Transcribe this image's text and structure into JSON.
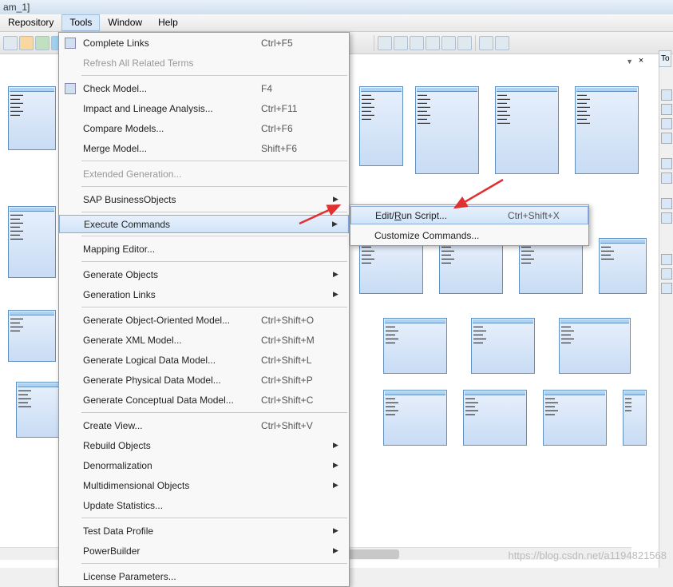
{
  "window": {
    "title_fragment": "am_1]"
  },
  "menubar": {
    "items": [
      "Repository",
      "Tools",
      "Window",
      "Help"
    ],
    "active": "Tools"
  },
  "right_tab": "To",
  "tools_menu": {
    "groups": [
      [
        {
          "icon": true,
          "label": "Complete Links",
          "shortcut": "Ctrl+F5"
        },
        {
          "icon": false,
          "label": "Refresh All Related Terms",
          "disabled": true
        }
      ],
      [
        {
          "icon": true,
          "label": "Check Model...",
          "shortcut": "F4"
        },
        {
          "icon": false,
          "label": "Impact and Lineage Analysis...",
          "shortcut": "Ctrl+F11"
        },
        {
          "icon": false,
          "label": "Compare Models...",
          "shortcut": "Ctrl+F6"
        },
        {
          "icon": false,
          "label": "Merge Model...",
          "shortcut": "Shift+F6"
        }
      ],
      [
        {
          "icon": false,
          "label": "Extended Generation...",
          "disabled": true
        }
      ],
      [
        {
          "icon": false,
          "label": "SAP BusinessObjects",
          "submenu": true
        }
      ],
      [
        {
          "icon": false,
          "label": "Execute Commands",
          "submenu": true,
          "hover": true
        }
      ],
      [
        {
          "icon": false,
          "label": "Mapping Editor..."
        }
      ],
      [
        {
          "icon": false,
          "label": "Generate Objects",
          "submenu": true
        },
        {
          "icon": false,
          "label": "Generation Links",
          "submenu": true
        }
      ],
      [
        {
          "icon": false,
          "label": "Generate Object-Oriented Model...",
          "shortcut": "Ctrl+Shift+O"
        },
        {
          "icon": false,
          "label": "Generate XML Model...",
          "shortcut": "Ctrl+Shift+M"
        },
        {
          "icon": false,
          "label": "Generate Logical Data Model...",
          "shortcut": "Ctrl+Shift+L"
        },
        {
          "icon": false,
          "label": "Generate Physical Data Model...",
          "shortcut": "Ctrl+Shift+P"
        },
        {
          "icon": false,
          "label": "Generate Conceptual Data Model...",
          "shortcut": "Ctrl+Shift+C"
        }
      ],
      [
        {
          "icon": false,
          "label": "Create View...",
          "shortcut": "Ctrl+Shift+V"
        },
        {
          "icon": false,
          "label": "Rebuild Objects",
          "submenu": true
        },
        {
          "icon": false,
          "label": "Denormalization",
          "submenu": true
        },
        {
          "icon": false,
          "label": "Multidimensional Objects",
          "submenu": true
        },
        {
          "icon": false,
          "label": "Update Statistics..."
        }
      ],
      [
        {
          "icon": false,
          "label": "Test Data Profile",
          "submenu": true
        },
        {
          "icon": false,
          "label": "PowerBuilder",
          "submenu": true
        }
      ],
      [
        {
          "icon": false,
          "label": "License Parameters..."
        }
      ]
    ]
  },
  "submenu": {
    "items": [
      {
        "label": "Edit/Run Script...",
        "shortcut": "Ctrl+Shift+X",
        "hover": true,
        "underline_char": "R"
      },
      {
        "label": "Customize Commands..."
      }
    ]
  },
  "watermark": "https://blog.csdn.net/a1194821568"
}
